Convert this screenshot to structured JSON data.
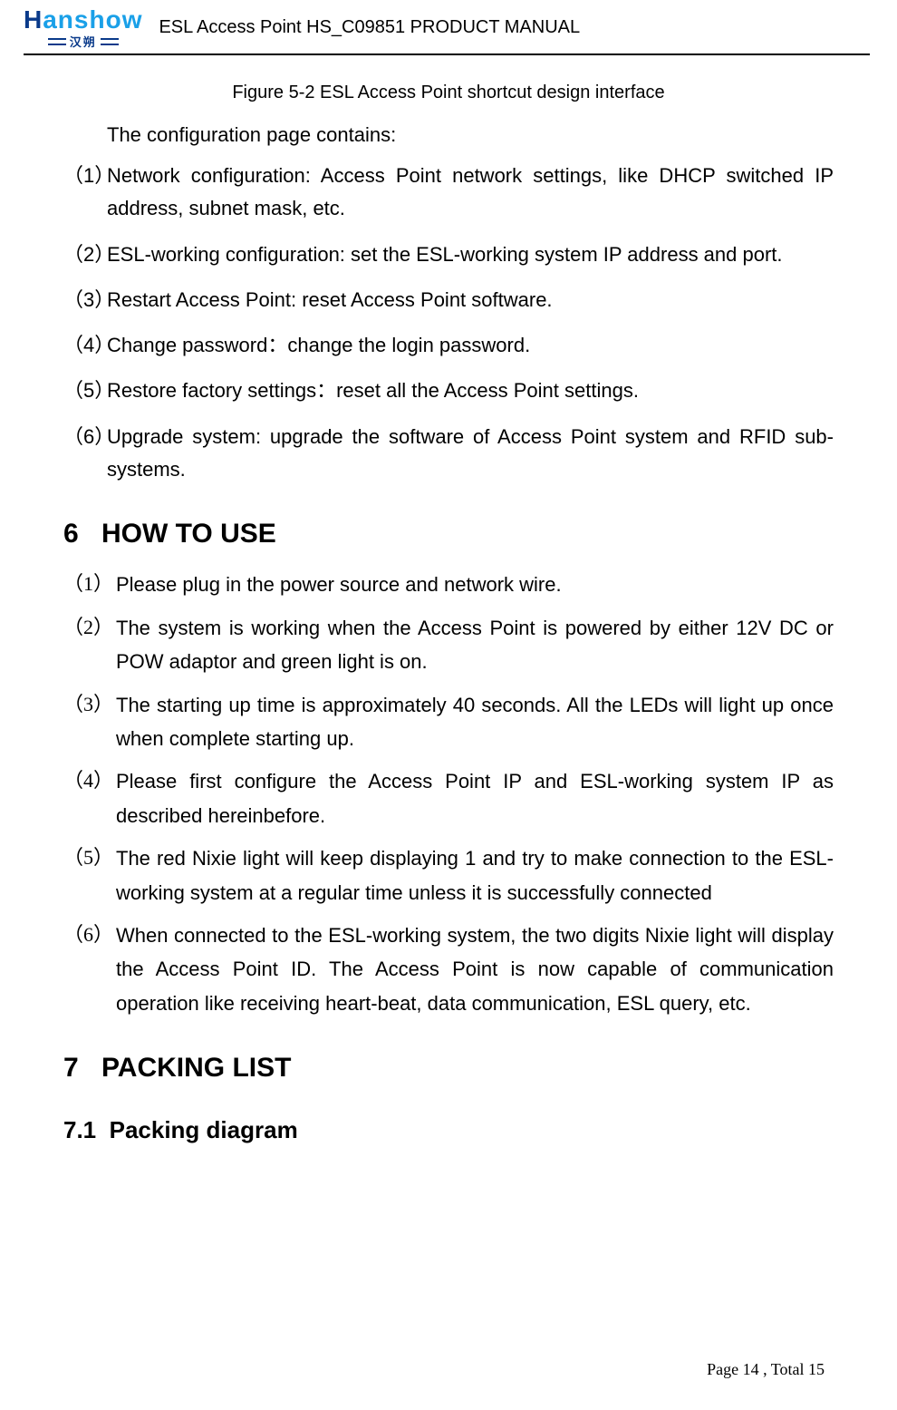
{
  "header": {
    "logo_brand_first": "H",
    "logo_brand_rest": "anshow",
    "logo_sub": "汉朔",
    "title": "ESL Access Point HS_C09851 PRODUCT MANUAL"
  },
  "figure_caption": "Figure 5-2 ESL Access Point shortcut design interface",
  "intro": "The configuration page contains:",
  "list_a": [
    {
      "num": "（1）",
      "text": "Network configuration: Access Point network settings, like DHCP switched IP address, subnet mask, etc."
    },
    {
      "num": "（2）",
      "text": "ESL-working configuration: set the ESL-working system IP address and port."
    },
    {
      "num": "（3）",
      "text": "Restart Access Point: reset Access Point software."
    },
    {
      "num": "（4）",
      "text": "Change password：change the login password."
    },
    {
      "num": "（5）",
      "text": "Restore factory settings：reset all the Access Point settings."
    },
    {
      "num": "（6）",
      "text": "Upgrade system: upgrade the software of Access Point system and RFID sub-systems."
    }
  ],
  "section6": {
    "num": "6",
    "title": "HOW TO USE"
  },
  "list_b": [
    {
      "num": "（1）",
      "text": "Please plug in the power source and network wire."
    },
    {
      "num": "（2）",
      "text": "The system is working when the Access Point is powered by either 12V DC or POW adaptor and green light is on."
    },
    {
      "num": "（3）",
      "text": "The starting up time is approximately 40 seconds. All the LEDs will light up once when complete starting up."
    },
    {
      "num": "（4）",
      "text": "Please first configure the Access Point IP and ESL-working system IP as described hereinbefore."
    },
    {
      "num": "（5）",
      "text": "The red Nixie light will keep displaying 1 and try to make connection to the ESL-working system at a regular time unless it is successfully connected"
    },
    {
      "num": "（6）",
      "text": "When connected to the ESL-working system, the two digits Nixie light will display the Access Point ID. The Access Point is now capable of communication operation like receiving heart-beat, data communication, ESL query, etc."
    }
  ],
  "section7": {
    "num": "7",
    "title": "PACKING LIST"
  },
  "section7_1": {
    "num": "7.1",
    "title": "Packing diagram"
  },
  "footer": "Page 14 , Total 15"
}
